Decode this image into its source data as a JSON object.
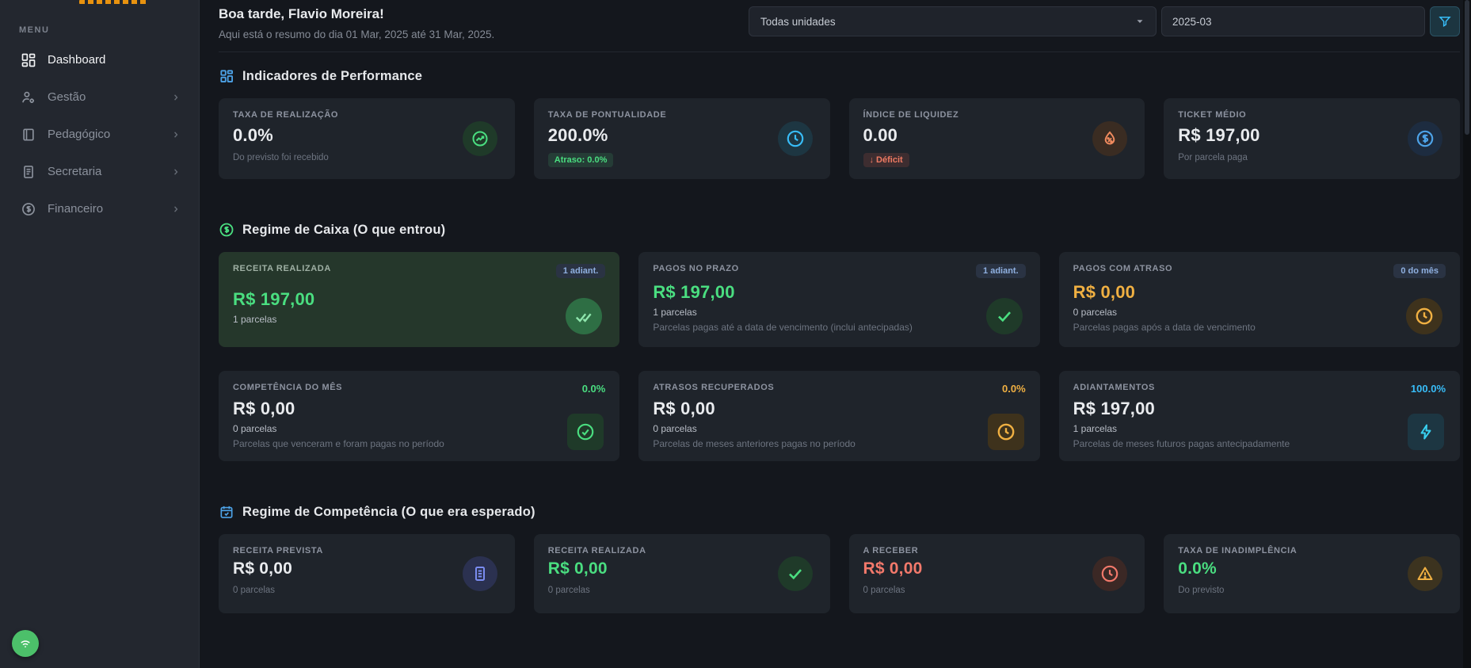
{
  "sidebar": {
    "menu_label": "MENU",
    "items": [
      {
        "label": "Dashboard"
      },
      {
        "label": "Gestão"
      },
      {
        "label": "Pedagógico"
      },
      {
        "label": "Secretaria"
      },
      {
        "label": "Financeiro"
      }
    ]
  },
  "header": {
    "greeting": "Boa tarde, Flavio Moreira!",
    "subtitle": "Aqui está o resumo do dia 01 Mar, 2025 até 31 Mar, 2025.",
    "unit_select_value": "Todas unidades",
    "month_input_value": "2025-03"
  },
  "sections": {
    "performance": {
      "title": "Indicadores de Performance",
      "cards": [
        {
          "title": "TAXA DE REALIZAÇÃO",
          "value": "0.0%",
          "sub": "Do previsto foi recebido",
          "icon": "trending-up"
        },
        {
          "title": "TAXA DE PONTUALIDADE",
          "value": "200.0%",
          "badge": "Atraso: 0.0%",
          "icon": "clock"
        },
        {
          "title": "ÍNDICE DE LIQUIDEZ",
          "value": "0.00",
          "badge": "↓ Déficit",
          "icon": "droplet-percent"
        },
        {
          "title": "TICKET MÉDIO",
          "value": "R$ 197,00",
          "sub": "Por parcela paga",
          "icon": "dollar-circle"
        }
      ]
    },
    "caixa": {
      "title": "Regime de Caixa (O que entrou)",
      "row1": [
        {
          "title": "RECEITA REALIZADA",
          "badge": "1 adiant.",
          "value": "R$ 197,00",
          "parcelas": "1 parcelas",
          "icon": "double-check"
        },
        {
          "title": "PAGOS NO PRAZO",
          "badge": "1 adiant.",
          "value": "R$ 197,00",
          "parcelas": "1 parcelas",
          "desc": "Parcelas pagas até a data de vencimento (inclui antecipadas)",
          "icon": "check"
        },
        {
          "title": "PAGOS COM ATRASO",
          "badge": "0 do mês",
          "value": "R$ 0,00",
          "parcelas": "0 parcelas",
          "desc": "Parcelas pagas após a data de vencimento",
          "icon": "clock"
        }
      ],
      "row2": [
        {
          "title": "COMPETÊNCIA DO MÊS",
          "pct": "0.0%",
          "value": "R$ 0,00",
          "parcelas": "0 parcelas",
          "desc": "Parcelas que venceram e foram pagas no período",
          "icon": "check-circle"
        },
        {
          "title": "ATRASOS RECUPERADOS",
          "pct": "0.0%",
          "value": "R$ 0,00",
          "parcelas": "0 parcelas",
          "desc": "Parcelas de meses anteriores pagas no período",
          "icon": "clock"
        },
        {
          "title": "ADIANTAMENTOS",
          "pct": "100.0%",
          "value": "R$ 197,00",
          "parcelas": "1 parcelas",
          "desc": "Parcelas de meses futuros pagas antecipadamente",
          "icon": "lightning"
        }
      ]
    },
    "competencia": {
      "title": "Regime de Competência (O que era esperado)",
      "cards": [
        {
          "title": "RECEITA PREVISTA",
          "value": "R$ 0,00",
          "parcelas": "0 parcelas",
          "icon": "document"
        },
        {
          "title": "RECEITA REALIZADA",
          "value": "R$ 0,00",
          "parcelas": "0 parcelas",
          "icon": "check"
        },
        {
          "title": "A RECEBER",
          "value": "R$ 0,00",
          "parcelas": "0 parcelas",
          "icon": "clock"
        },
        {
          "title": "TAXA DE INADIMPLÊNCIA",
          "value": "0.0%",
          "parcelas": "Do previsto",
          "icon": "warning-triangle"
        }
      ]
    }
  },
  "colors": {
    "accent_green": "#4ade80",
    "accent_amber": "#f0b042",
    "accent_cyan": "#38bdf8",
    "accent_blue": "#4da3e8",
    "accent_red": "#f3796b",
    "accent_indigo": "#7a8cf0",
    "badge_blue_text": "#8fb0e0",
    "card_bg": "#1f242b",
    "card_bg_highlight": "#25372b",
    "sidebar_bg": "#23272f",
    "page_bg": "#14171d"
  }
}
